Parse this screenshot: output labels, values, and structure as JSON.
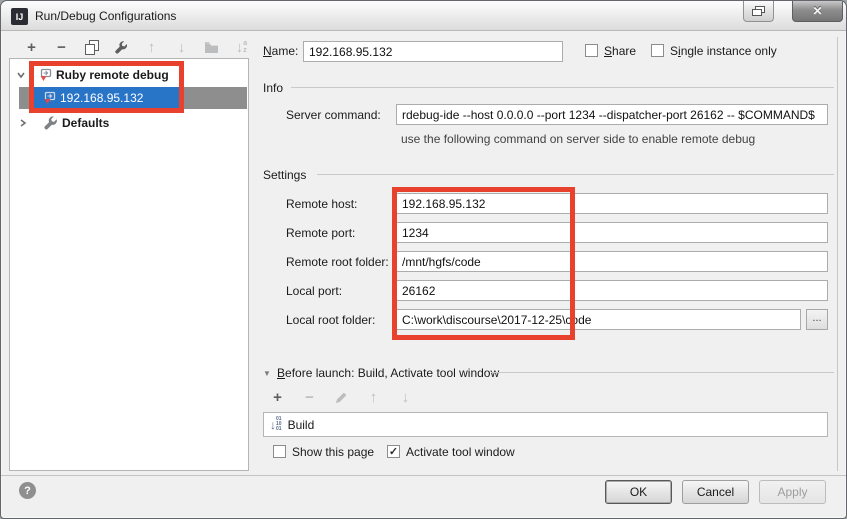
{
  "window": {
    "title": "Run/Debug Configurations",
    "logo_text": "IJ"
  },
  "icons": {
    "add": "+",
    "remove": "−",
    "arrow_up": "↑",
    "arrow_down": "↓",
    "sort_letters": [
      "a",
      "z"
    ],
    "check": "✓",
    "close": "✕",
    "help": "?",
    "browse": "...",
    "collapse_triangle": "▼",
    "build_digits": [
      "01",
      "10",
      "01"
    ]
  },
  "tree": {
    "items": [
      {
        "label": "Ruby remote debug"
      },
      {
        "label": "192.168.95.132"
      },
      {
        "label": "Defaults"
      }
    ]
  },
  "form": {
    "name": {
      "mnemonic": "N",
      "rest": "ame:",
      "value": "192.168.95.132"
    },
    "share": {
      "mnemonic": "S",
      "rest": "hare",
      "checked": false
    },
    "single_instance": {
      "pre": "S",
      "mnemonic": "i",
      "rest": "ngle instance only",
      "checked": false
    },
    "info": {
      "header": "Info",
      "server_command_label": "Server command:",
      "server_command_value": "rdebug-ide --host 0.0.0.0 --port 1234 --dispatcher-port 26162 -- $COMMAND$",
      "server_command_hint": "use the following command on server side to enable remote debug"
    },
    "settings": {
      "header": "Settings",
      "fields": [
        {
          "label": "Remote host:",
          "value": "192.168.95.132"
        },
        {
          "label": "Remote port:",
          "value": "1234"
        },
        {
          "label": "Remote root folder:",
          "value": "/mnt/hgfs/code"
        },
        {
          "label": "Local port:",
          "value": "26162"
        },
        {
          "label": "Local root folder:",
          "value": "C:\\work\\discourse\\2017-12-25\\code"
        }
      ]
    },
    "before_launch": {
      "mnemonic": "B",
      "rest": "efore launch: Build, Activate tool window",
      "items": [
        {
          "label": "Build"
        }
      ]
    },
    "show_this_page": "Show this page",
    "activate_tool_window": "Activate tool window"
  },
  "footer": {
    "ok": "OK",
    "cancel": "Cancel",
    "apply": "Apply"
  },
  "colors": {
    "selection_blue": "#2874c7",
    "selection_gray": "#8e8e8e",
    "annotation_red": "#e8422f"
  }
}
